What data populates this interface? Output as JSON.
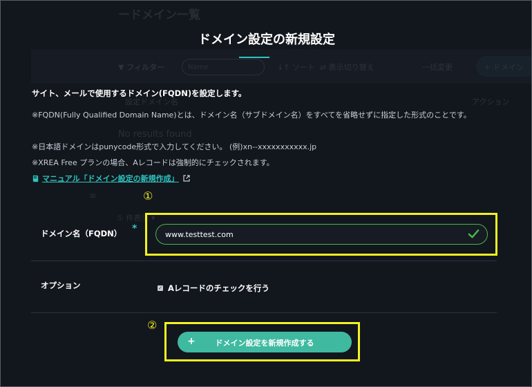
{
  "background": {
    "title": "ードメイン一覧",
    "filter_label": "▼ フィルター",
    "search_placeholder": "Name",
    "sort_label": "↓↑ ソート",
    "switch_label": "⇄ 表示切り替え",
    "bulk_label": "一括変更",
    "new_label": "+ ドメイン",
    "column_name": "設定ドメイン名",
    "column_action": "アクション",
    "no_results": "No results found",
    "menu_glyph": "≡",
    "pager_label": "① 件表示 ▾"
  },
  "modal": {
    "title": "ドメイン設定の新規設定",
    "intro": "サイト、メールで使用するドメイン(FQDN)を設定します。",
    "notes": [
      "※FQDN(Fully Qualified Domain Name)とは、ドメイン名（サブドメイン名）をすべてを省略せずに指定した形式のことです。",
      "※日本語ドメインはpunycode形式で入力してください。 (例)xn--xxxxxxxxxxx.jp",
      "※XREA Free プランの場合、Aレコードは強制的にチェックされます。"
    ],
    "manual_link": "マニュアル「ドメイン設定の新規作成」"
  },
  "annotations": {
    "marker1": "①",
    "marker2": "②",
    "highlight_color": "#f5f222"
  },
  "form": {
    "domain_label": "ドメイン名（FQDN）",
    "required_mark": "*",
    "domain_value": "www.testtest.com",
    "valid_icon": "checkmark-icon",
    "option_label": "オプション",
    "arecord_checkbox_label": "Aレコードのチェックを行う",
    "arecord_checked": true,
    "submit_icon": "+",
    "submit_label": "ドメイン設定を新規作成する"
  },
  "colors": {
    "accent": "#2ec4c0",
    "valid": "#48b84a",
    "button": "#3fb9a0",
    "background": "#12161d"
  }
}
